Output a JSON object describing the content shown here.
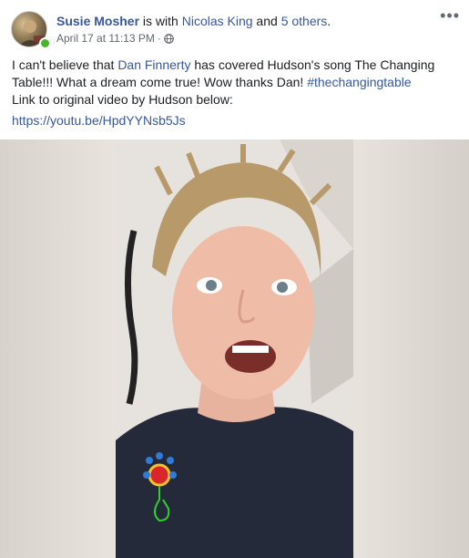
{
  "post": {
    "author": "Susie Mosher",
    "with_text": " is with ",
    "tagged_person": "Nicolas King",
    "and_text": " and ",
    "others": "5 others",
    "period": ".",
    "date": "April 17 at 11:13 PM",
    "separator": "·",
    "privacy_icon": "globe-icon",
    "more_icon": "more-options-icon",
    "text_part1": "I can't believe that ",
    "mention": "Dan Finnerty",
    "text_part2": " has covered Hudson's song The Changing Table!!! What a dream come true! Wow thanks Dan! ",
    "hashtag": "#thechangingtable",
    "text_part3": "Link to original video by Hudson below:",
    "link": "https://youtu.be/HpdYYNsb5Js"
  },
  "colors": {
    "link": "#385898",
    "text": "#1c1e21",
    "meta": "#616770",
    "online": "#42b72a"
  }
}
